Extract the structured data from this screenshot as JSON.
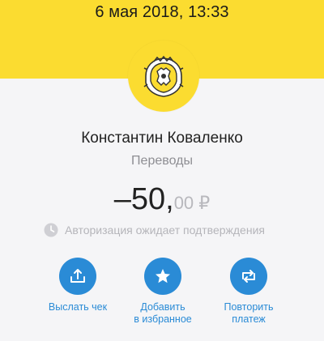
{
  "header": {
    "datetime": "6 мая 2018, 13:33"
  },
  "logo": {
    "icon": "bank-emblem-icon",
    "color": "#fbdc30"
  },
  "transaction": {
    "recipient": "Константин Коваленко",
    "category": "Переводы",
    "amount_main": "–50,",
    "amount_cents": "00 ₽",
    "status_icon": "clock-icon",
    "status_text": "Авторизация ожидает подтверждения"
  },
  "actions": [
    {
      "icon": "upload-icon",
      "label_line1": "Выслать чек",
      "label_line2": ""
    },
    {
      "icon": "star-icon",
      "label_line1": "Добавить",
      "label_line2": "в избранное"
    },
    {
      "icon": "repeat-icon",
      "label_line1": "Повторить",
      "label_line2": "платеж"
    }
  ],
  "colors": {
    "accent_yellow": "#fbdc30",
    "action_blue": "#2a8bd6",
    "muted_text": "#b5b5ba"
  }
}
